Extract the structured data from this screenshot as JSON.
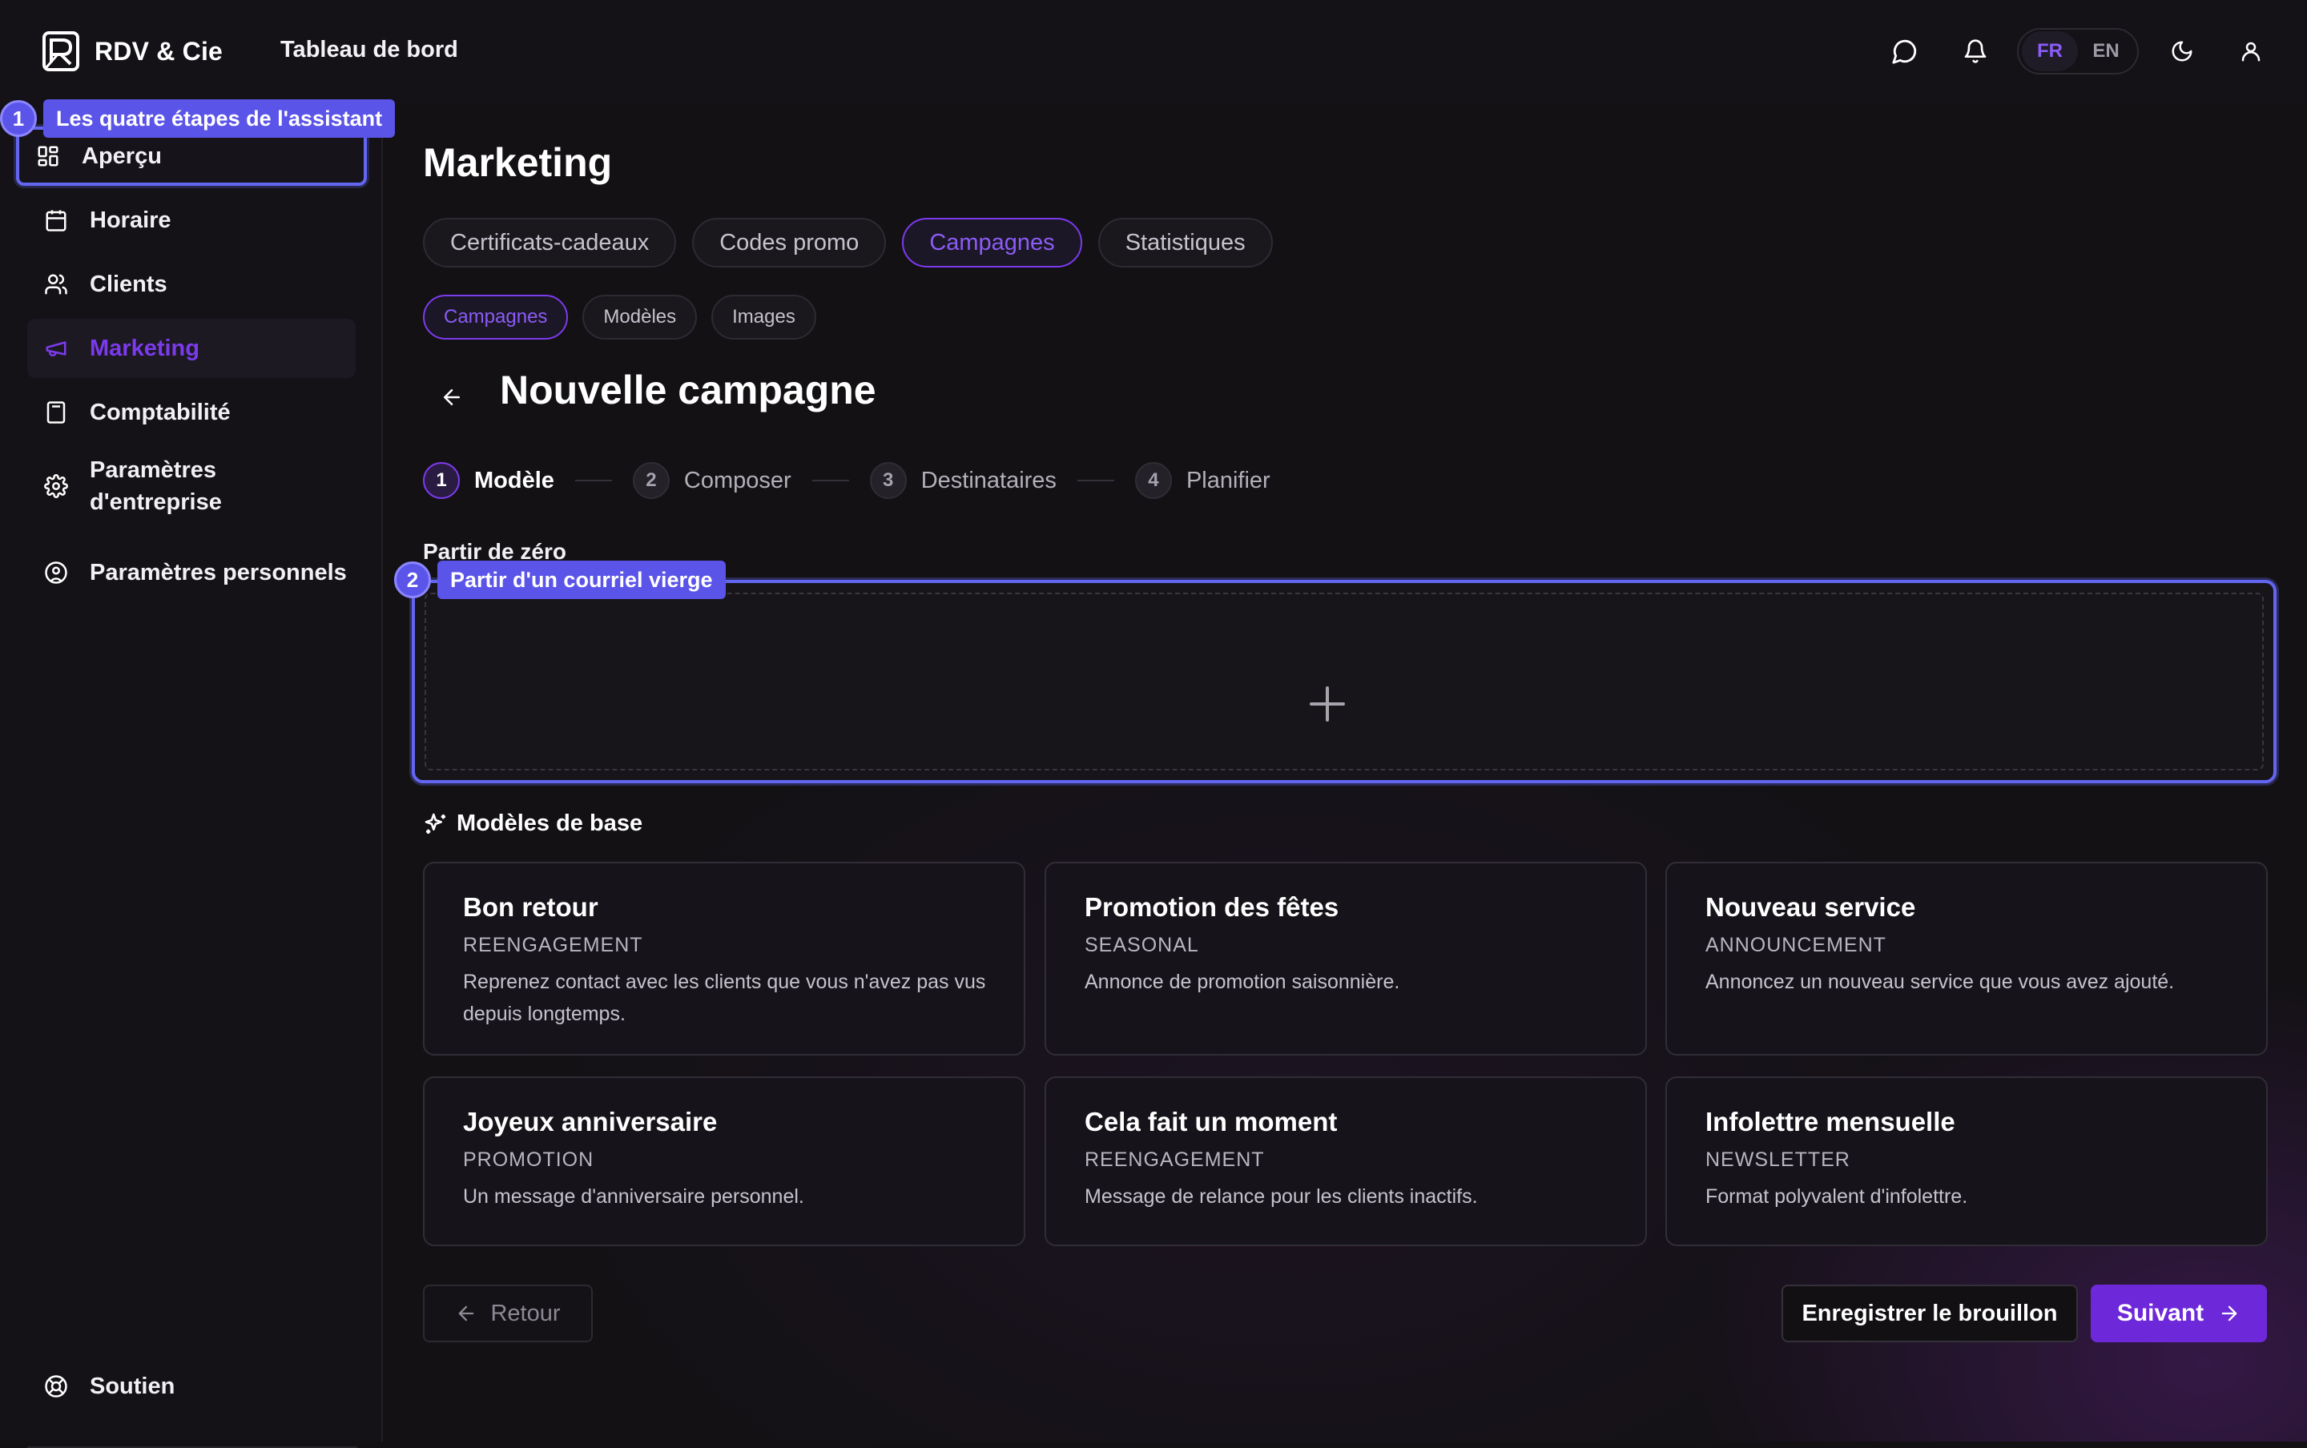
{
  "app": {
    "name": "RDV & Cie",
    "header_title": "Tableau de bord"
  },
  "header": {
    "languages": [
      "FR",
      "EN"
    ],
    "active_language": "FR",
    "icons": [
      "chat-icon",
      "bell-icon",
      "moon-icon",
      "user-icon"
    ]
  },
  "sidebar": {
    "items": [
      {
        "label": "Aperçu",
        "icon": "dashboard-icon"
      },
      {
        "label": "Horaire",
        "icon": "calendar-icon"
      },
      {
        "label": "Clients",
        "icon": "users-icon"
      },
      {
        "label": "Marketing",
        "icon": "megaphone-icon",
        "active": true
      },
      {
        "label": "Comptabilité",
        "icon": "calculator-icon"
      },
      {
        "label": "Paramètres d'entreprise",
        "icon": "gear-icon"
      },
      {
        "label": "Paramètres personnels",
        "icon": "user-circle-icon"
      }
    ],
    "support_label": "Soutien"
  },
  "tour": {
    "step1_num": "1",
    "step1_label": "Les quatre étapes de l'assistant",
    "step2_num": "2",
    "step2_label": "Partir d'un courriel vierge"
  },
  "main": {
    "page_title": "Marketing",
    "tabs": [
      "Certificats-cadeaux",
      "Codes promo",
      "Campagnes",
      "Statistiques"
    ],
    "active_tab": "Campagnes",
    "subtabs": [
      "Campagnes",
      "Modèles",
      "Images"
    ],
    "active_subtab": "Campagnes",
    "campaign_title": "Nouvelle campagne",
    "steps": [
      {
        "num": "1",
        "label": "Modèle"
      },
      {
        "num": "2",
        "label": "Composer"
      },
      {
        "num": "3",
        "label": "Destinataires"
      },
      {
        "num": "4",
        "label": "Planifier"
      }
    ],
    "active_step": 1,
    "scratch_label": "Partir de zéro",
    "base_templates_title": "Modèles de base",
    "templates": [
      {
        "name": "Bon retour",
        "category": "REENGAGEMENT",
        "description": "Reprenez contact avec les clients que vous n'avez pas vus depuis longtemps."
      },
      {
        "name": "Promotion des fêtes",
        "category": "SEASONAL",
        "description": "Annonce de promotion saisonnière."
      },
      {
        "name": "Nouveau service",
        "category": "ANNOUNCEMENT",
        "description": "Annoncez un nouveau service que vous avez ajouté."
      },
      {
        "name": "Joyeux anniversaire",
        "category": "PROMOTION",
        "description": "Un message d'anniversaire personnel."
      },
      {
        "name": "Cela fait un moment",
        "category": "REENGAGEMENT",
        "description": "Message de relance pour les clients inactifs."
      },
      {
        "name": "Infolettre mensuelle",
        "category": "NEWSLETTER",
        "description": "Format polyvalent d'infolettre."
      }
    ],
    "back_label": "Retour",
    "save_draft_label": "Enregistrer le brouillon",
    "next_label": "Suivant"
  },
  "colors": {
    "accent": "#7c3aed",
    "tour": "#5b54e8",
    "background": "#131114"
  }
}
